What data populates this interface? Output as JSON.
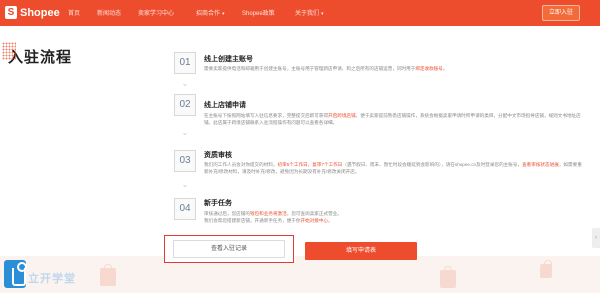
{
  "header": {
    "logo_text": "Shopee",
    "nav": [
      {
        "label": "首页"
      },
      {
        "label": "新闻动态"
      },
      {
        "label": "卖家学习中心"
      },
      {
        "label": "招商合作"
      },
      {
        "label": "Shopee政策"
      },
      {
        "label": "关于我们"
      }
    ],
    "signin_label": "立即入驻",
    "accent_color": "#ee4d2d"
  },
  "hero": {
    "title": "入驻流程"
  },
  "steps": [
    {
      "number": "01",
      "title": "线上创建主账号",
      "desc_parts": [
        {
          "text": "需要卖家提供电话和邮箱用于创建主账号，主账号用于管理新店申请、和之后所有的店铺运营，同时用于"
        },
        {
          "text": "绑定收款账号",
          "style": "lk"
        },
        {
          "text": "。"
        }
      ]
    },
    {
      "number": "02",
      "title": "线上店铺申请",
      "desc_parts": [
        {
          "text": "在主账号下按照网站填写入驻信息要求，完整提交后即可获得"
        },
        {
          "text": "开启跨境店铺",
          "style": "hl"
        },
        {
          "text": "，便于卖家提前熟悉店铺操作，系统会根据卖家申请时所申请的类目，分配中文市场指导店铺，规则文书地址店铺，此店属于跨境店铺联系入驻流程操作有问题可以查看各详细。"
        }
      ]
    },
    {
      "number": "03",
      "title": "资质审核",
      "desc_parts": [
        {
          "text": "我们的工作人员会对你提交的材料，"
        },
        {
          "text": "初审5个工作日，复审7个工作日",
          "style": "hl"
        },
        {
          "text": "（遇节假日、周末、暂忙时段会顺延到会影响的），请在shopee.cn及时登录您的主账号，"
        },
        {
          "text": "查看审核状态进展",
          "style": "lk"
        },
        {
          "text": "，如需要重新补充/修改材料，请及时补充/修改，避免因为长期没有补充/修改关闭开店。"
        }
      ]
    },
    {
      "number": "04",
      "title": "新手任务",
      "desc_parts": [
        {
          "text": "审核通过后，您店铺的"
        },
        {
          "text": "钱包和业务将激活",
          "style": "hl"
        },
        {
          "text": "，您可查阅卖家正式营业。"
        },
        {
          "text": "\n我们会帮您搭建新店铺，开通新手任务，便于你"
        },
        {
          "text": "开始对接中心",
          "style": "lk"
        },
        {
          "text": "。"
        }
      ]
    }
  ],
  "bottom": {
    "watermark": "立开学堂",
    "records_label": "查看入驻记录",
    "apply_label": "填写申请表"
  }
}
